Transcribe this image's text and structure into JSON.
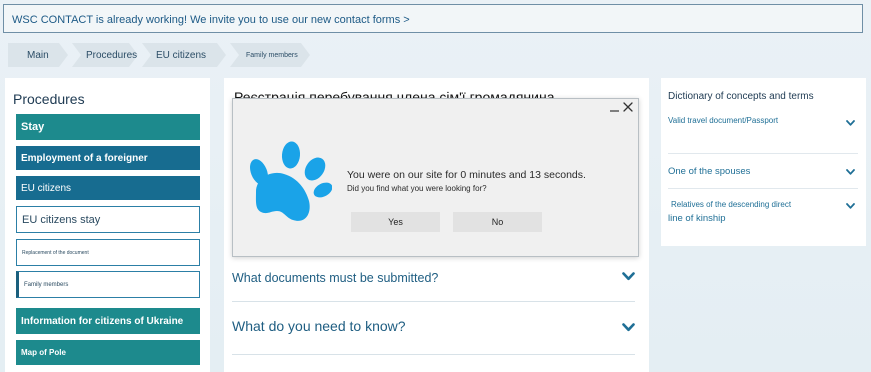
{
  "banner": {
    "text": "WSC CONTACT is already working! We invite you to use our new contact forms >"
  },
  "breadcrumb": [
    "Main",
    "Procedures",
    "EU citizens",
    "Family members"
  ],
  "sidebar": {
    "title": "Procedures",
    "items": [
      {
        "label": "Stay"
      },
      {
        "label": "Employment of a foreigner"
      },
      {
        "label": "EU citizens"
      },
      {
        "label": "EU citizens stay"
      },
      {
        "label": "Replacement of the document"
      },
      {
        "label": "Family members"
      },
      {
        "label": "Information for citizens of Ukraine"
      },
      {
        "label": "Map of Pole"
      }
    ]
  },
  "main": {
    "title": "Реєстрація перебування члена сім'ї громадянина",
    "accordion": [
      {
        "label": "What documents must be submitted?",
        "icon": "chevron-down-icon"
      },
      {
        "label": "What do you need to know?",
        "icon": "chevron-down-icon"
      }
    ]
  },
  "dictionary": {
    "title": "Dictionary of concepts and terms",
    "items": [
      {
        "label": "Valid travel document/Passport",
        "icon": "chevron-down-icon"
      },
      {
        "label": "One of the spouses",
        "icon": "chevron-down-icon"
      },
      {
        "label_line1": "Relatives of the descending direct",
        "label_line2": "line of kinship",
        "icon": "chevron-down-icon"
      }
    ]
  },
  "modal": {
    "line1": "You were on our site for 0 minutes and 13 seconds.",
    "line2": "Did you find what you were looking for?",
    "yes_label": "Yes",
    "no_label": "No",
    "icon": "paw-icon",
    "paw_color": "#1aa3e8"
  },
  "colors": {
    "teal": "#1d8a8d",
    "blue": "#176c90",
    "link": "#1f5e82",
    "paw": "#1aa3e8"
  }
}
